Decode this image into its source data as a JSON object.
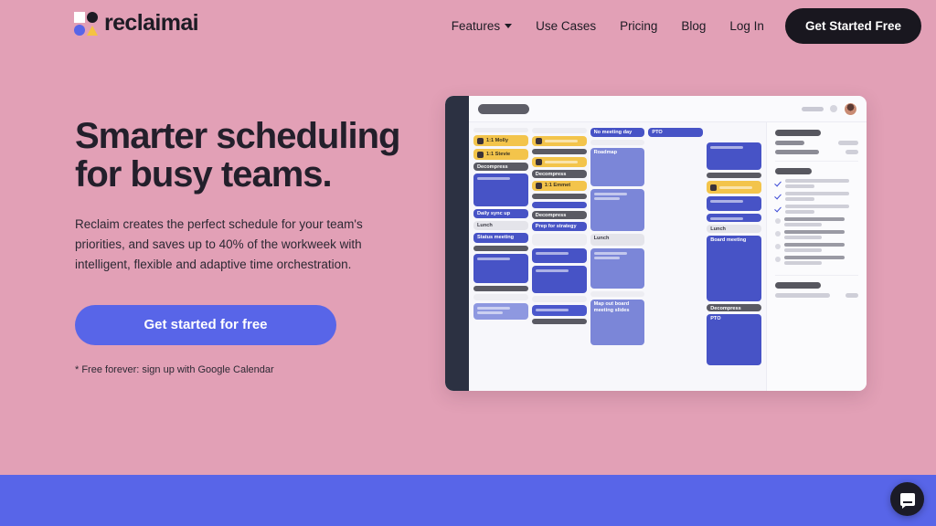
{
  "brand": {
    "name": "reclaimai",
    "logo_icon": "reclaim-logo-icon",
    "colors": {
      "page_bg": "#e2a0b6",
      "accent_blue": "#5865e8",
      "dark": "#19171f",
      "yellow": "#f3c44b"
    }
  },
  "nav": {
    "links": [
      {
        "label": "Features",
        "has_caret": true
      },
      {
        "label": "Use Cases",
        "has_caret": false
      },
      {
        "label": "Pricing",
        "has_caret": false
      },
      {
        "label": "Blog",
        "has_caret": false
      },
      {
        "label": "Log In",
        "has_caret": false
      }
    ],
    "cta_label": "Get Started Free"
  },
  "hero": {
    "title": "Smarter scheduling for busy teams.",
    "subtitle": "Reclaim creates the perfect schedule for your team's priorities, and saves up to 40% of the workweek with intelligent, flexible and adaptive time orchestration.",
    "cta_label": "Get started for free",
    "note": "* Free forever: sign up with Google Calendar"
  },
  "mockup": {
    "calendar_columns": [
      {
        "events": [
          {
            "text": "",
            "style": "skel-light",
            "h": 5
          },
          {
            "text": "1:1 Molly",
            "style": "yellow",
            "h": 12,
            "icon": "person-icon"
          },
          {
            "text": "1:1 Stevie",
            "style": "yellow",
            "h": 12,
            "icon": "person-icon"
          },
          {
            "text": "Decompress",
            "style": "dark",
            "h": 9
          },
          {
            "text": "",
            "style": "blue",
            "h": 36,
            "bars": 1
          },
          {
            "text": "Daily sync up",
            "style": "blue",
            "h": 10
          },
          {
            "text": "Lunch",
            "style": "gray",
            "h": 10
          },
          {
            "text": "Status meeting",
            "style": "blue",
            "h": 11
          },
          {
            "text": "",
            "style": "dark",
            "h": 6
          },
          {
            "text": "",
            "style": "blue",
            "h": 32,
            "bars": 1
          },
          {
            "text": "",
            "style": "dark",
            "h": 6
          },
          {
            "text": "",
            "style": "skel-light",
            "h": 7
          },
          {
            "text": "",
            "style": "ghostblue",
            "h": 18,
            "bars": 2
          }
        ]
      },
      {
        "events": [
          {
            "text": "",
            "style": "skel-light",
            "h": 6
          },
          {
            "text": "",
            "style": "yellow",
            "h": 11,
            "icon": "person-icon",
            "bars": 1
          },
          {
            "text": "",
            "style": "dark",
            "h": 6
          },
          {
            "text": "",
            "style": "yellow",
            "h": 11,
            "icon": "person-icon",
            "bars": 1
          },
          {
            "text": "Decompress",
            "style": "dark",
            "h": 9
          },
          {
            "text": "1:1 Emmet",
            "style": "yellow",
            "h": 11,
            "icon": "person-icon"
          },
          {
            "text": "",
            "style": "dark",
            "h": 6
          },
          {
            "text": "",
            "style": "blue",
            "h": 7
          },
          {
            "text": "Decompress",
            "style": "dark",
            "h": 9
          },
          {
            "text": "Prep for strategy",
            "style": "blue",
            "h": 10
          },
          {
            "text": "",
            "style": "skel-light",
            "h": 13
          },
          {
            "text": "",
            "style": "blue",
            "h": 16,
            "bars": 1
          },
          {
            "text": "",
            "style": "blue",
            "h": 30,
            "bars": 1
          },
          {
            "text": "",
            "style": "skel-light",
            "h": 7
          },
          {
            "text": "",
            "style": "blue2",
            "h": 12,
            "bars": 1
          },
          {
            "text": "",
            "style": "dark",
            "h": 6
          }
        ]
      },
      {
        "events": [
          {
            "text": "No meeting day",
            "style": "blue",
            "h": 10
          },
          {
            "text": "",
            "style": "skel-light",
            "h": 6
          },
          {
            "text": "Roadmap",
            "style": "periw",
            "h": 42
          },
          {
            "text": "",
            "style": "periw",
            "h": 46,
            "bars": 2
          },
          {
            "text": "Lunch",
            "style": "gray",
            "h": 13
          },
          {
            "text": "",
            "style": "periw",
            "h": 44,
            "bars": 2
          },
          {
            "text": "",
            "style": "skel-light",
            "h": 6
          },
          {
            "text": "Map out board meeting slides",
            "style": "periw",
            "h": 50
          }
        ]
      },
      {
        "events": [
          {
            "text": "PTO",
            "style": "blue",
            "h": 10
          }
        ]
      },
      {
        "events": [
          {
            "text": "",
            "style": "spacer",
            "h": 13
          },
          {
            "text": "",
            "style": "blue",
            "h": 30,
            "bars": 1
          },
          {
            "text": "",
            "style": "dark",
            "h": 6
          },
          {
            "text": "",
            "style": "yellow",
            "h": 14,
            "icon": "person-icon",
            "bars": 1
          },
          {
            "text": "",
            "style": "blue",
            "h": 16,
            "bars": 1
          },
          {
            "text": "",
            "style": "blue",
            "h": 9,
            "bars": 1
          },
          {
            "text": "Lunch",
            "style": "gray",
            "h": 9
          },
          {
            "text": "Board meeting",
            "style": "blue",
            "h": 72
          },
          {
            "text": "Decompress",
            "style": "dark",
            "h": 8
          },
          {
            "text": "PTO",
            "style": "blue",
            "h": 56
          }
        ]
      }
    ],
    "panel": {
      "tasks_checked": 3,
      "tasks_unchecked": 4
    }
  },
  "chat": {
    "icon": "chat-bubble-icon"
  }
}
